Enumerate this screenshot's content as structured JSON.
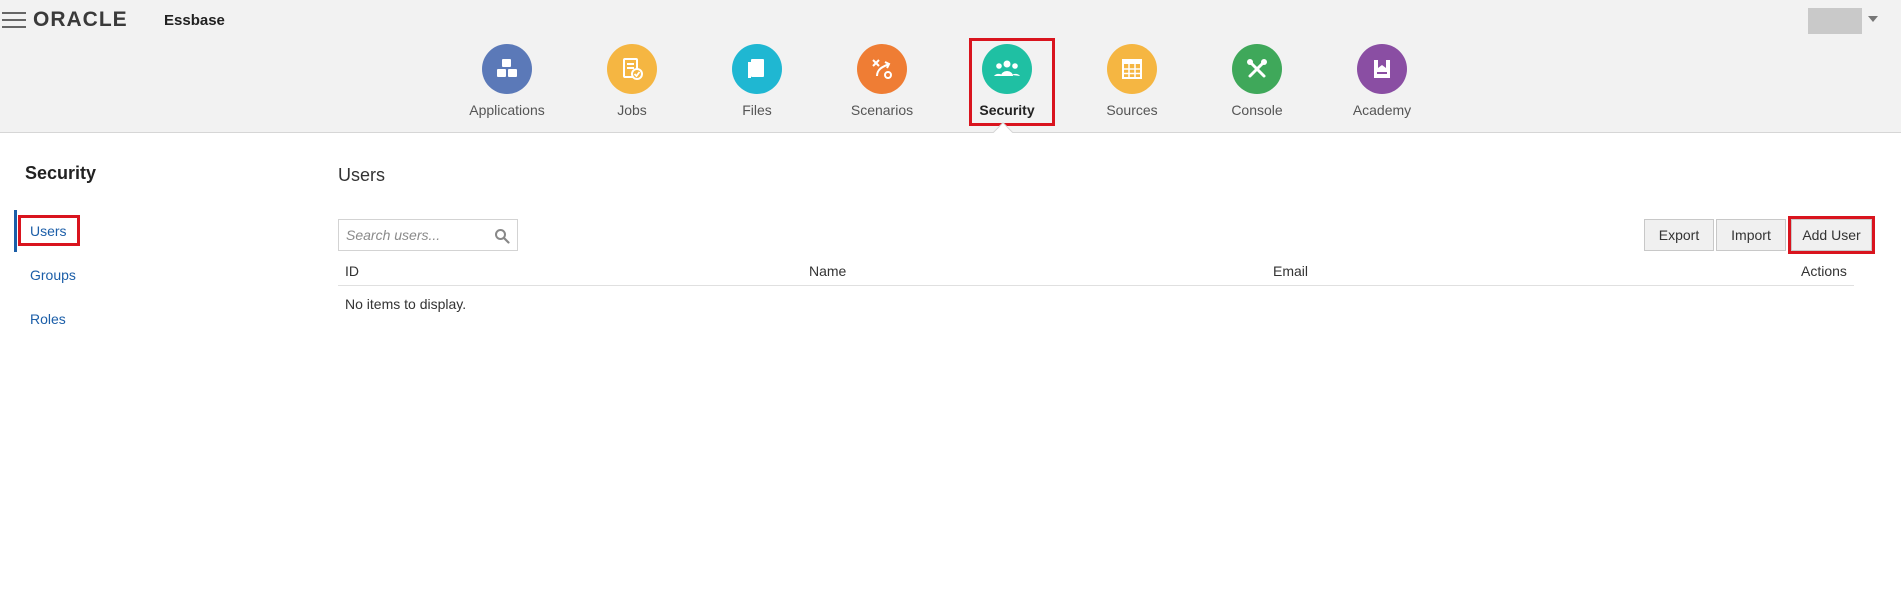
{
  "header": {
    "logo": "ORACLE",
    "app_name": "Essbase"
  },
  "nav": [
    {
      "label": "Applications",
      "icon": "cubes-icon",
      "color": "#5b79b8"
    },
    {
      "label": "Jobs",
      "icon": "jobs-check-icon",
      "color": "#f5b642"
    },
    {
      "label": "Files",
      "icon": "files-icon",
      "color": "#1fb7d2"
    },
    {
      "label": "Scenarios",
      "icon": "scenarios-icon",
      "color": "#ef7d34"
    },
    {
      "label": "Security",
      "icon": "users-group-icon",
      "color": "#1fc0a3",
      "active": true
    },
    {
      "label": "Sources",
      "icon": "table-icon",
      "color": "#f5b642"
    },
    {
      "label": "Console",
      "icon": "tools-icon",
      "color": "#3fa85a"
    },
    {
      "label": "Academy",
      "icon": "academy-icon",
      "color": "#8a4ea3"
    }
  ],
  "sidebar": {
    "title": "Security",
    "items": [
      {
        "label": "Users",
        "active": true
      },
      {
        "label": "Groups"
      },
      {
        "label": "Roles"
      }
    ]
  },
  "main": {
    "title": "Users",
    "search_placeholder": "Search users...",
    "buttons": {
      "export": "Export",
      "import": "Import",
      "add_user": "Add User"
    },
    "columns": [
      "ID",
      "Name",
      "Email",
      "Actions"
    ],
    "empty_message": "No items to display."
  },
  "colors": {
    "accent_red": "#d9141e",
    "link_blue": "#1b5ea8"
  }
}
